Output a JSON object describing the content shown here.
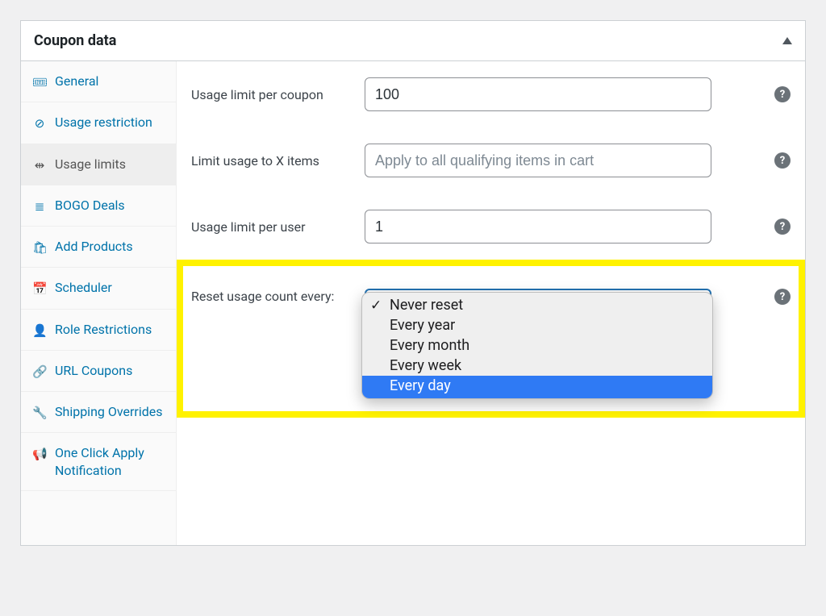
{
  "panel": {
    "title": "Coupon data"
  },
  "sidebar": {
    "items": [
      {
        "icon": "ticket",
        "label": "General"
      },
      {
        "icon": "ban",
        "label": "Usage restriction"
      },
      {
        "icon": "sliders",
        "label": "Usage limits",
        "active": true
      },
      {
        "icon": "stack",
        "label": "BOGO Deals"
      },
      {
        "icon": "bag",
        "label": "Add Products"
      },
      {
        "icon": "calendar",
        "label": "Scheduler"
      },
      {
        "icon": "user",
        "label": "Role Restrictions"
      },
      {
        "icon": "link",
        "label": "URL Coupons"
      },
      {
        "icon": "wrench",
        "label": "Shipping Overrides"
      },
      {
        "icon": "bullhorn",
        "label": "One Click Apply Notification"
      }
    ]
  },
  "fields": {
    "usage_limit_per_coupon": {
      "label": "Usage limit per coupon",
      "value": "100"
    },
    "limit_usage_items": {
      "label": "Limit usage to X items",
      "placeholder": "Apply to all qualifying items in cart"
    },
    "usage_limit_per_user": {
      "label": "Usage limit per user",
      "value": "1"
    },
    "reset_usage": {
      "label": "Reset usage count every:"
    }
  },
  "reset_usage_options": {
    "selected": "Never reset",
    "highlighted": "Every day",
    "items": [
      "Never reset",
      "Every year",
      "Every month",
      "Every week",
      "Every day"
    ]
  },
  "icons": {
    "ticket": "🎟",
    "ban": "⊘",
    "sliders": "⇹",
    "stack": "≣",
    "bag": "🛍",
    "calendar": "📅",
    "user": "👤",
    "link": "🔗",
    "wrench": "🔧",
    "bullhorn": "📢"
  },
  "help_glyph": "?"
}
